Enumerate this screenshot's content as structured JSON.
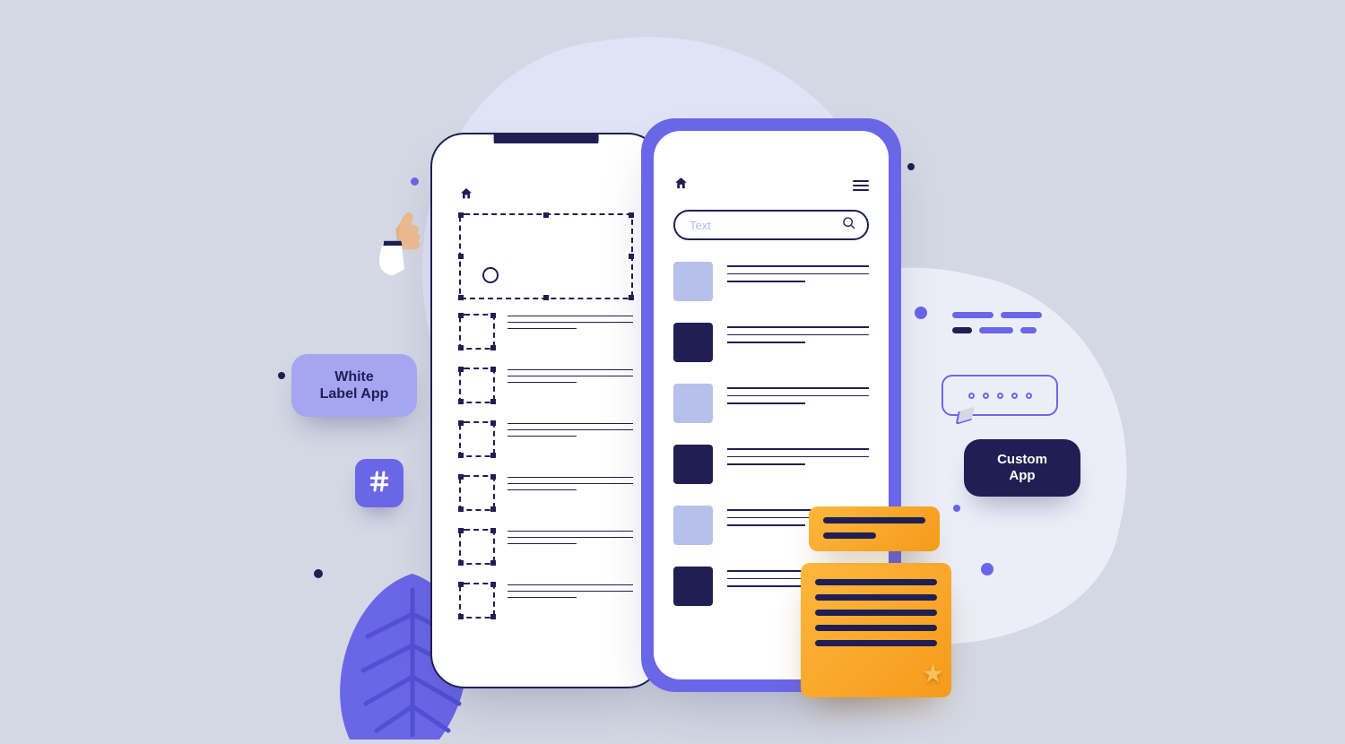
{
  "labels": {
    "white_label": "White\nLabel App",
    "custom_app": "Custom\nApp"
  },
  "front_phone": {
    "search_placeholder": "Text"
  },
  "icons": {
    "home": "home-icon",
    "hamburger": "hamburger-icon",
    "search": "search-icon",
    "hash": "hash-icon",
    "thumbs_up": "thumbs-up-icon",
    "star": "star-icon"
  },
  "colors": {
    "accent": "#6a66e8",
    "dark": "#201f54",
    "thumb_light": "#b7c0ea",
    "orange": "#f59a1b",
    "bg": "#d4d8e4"
  }
}
